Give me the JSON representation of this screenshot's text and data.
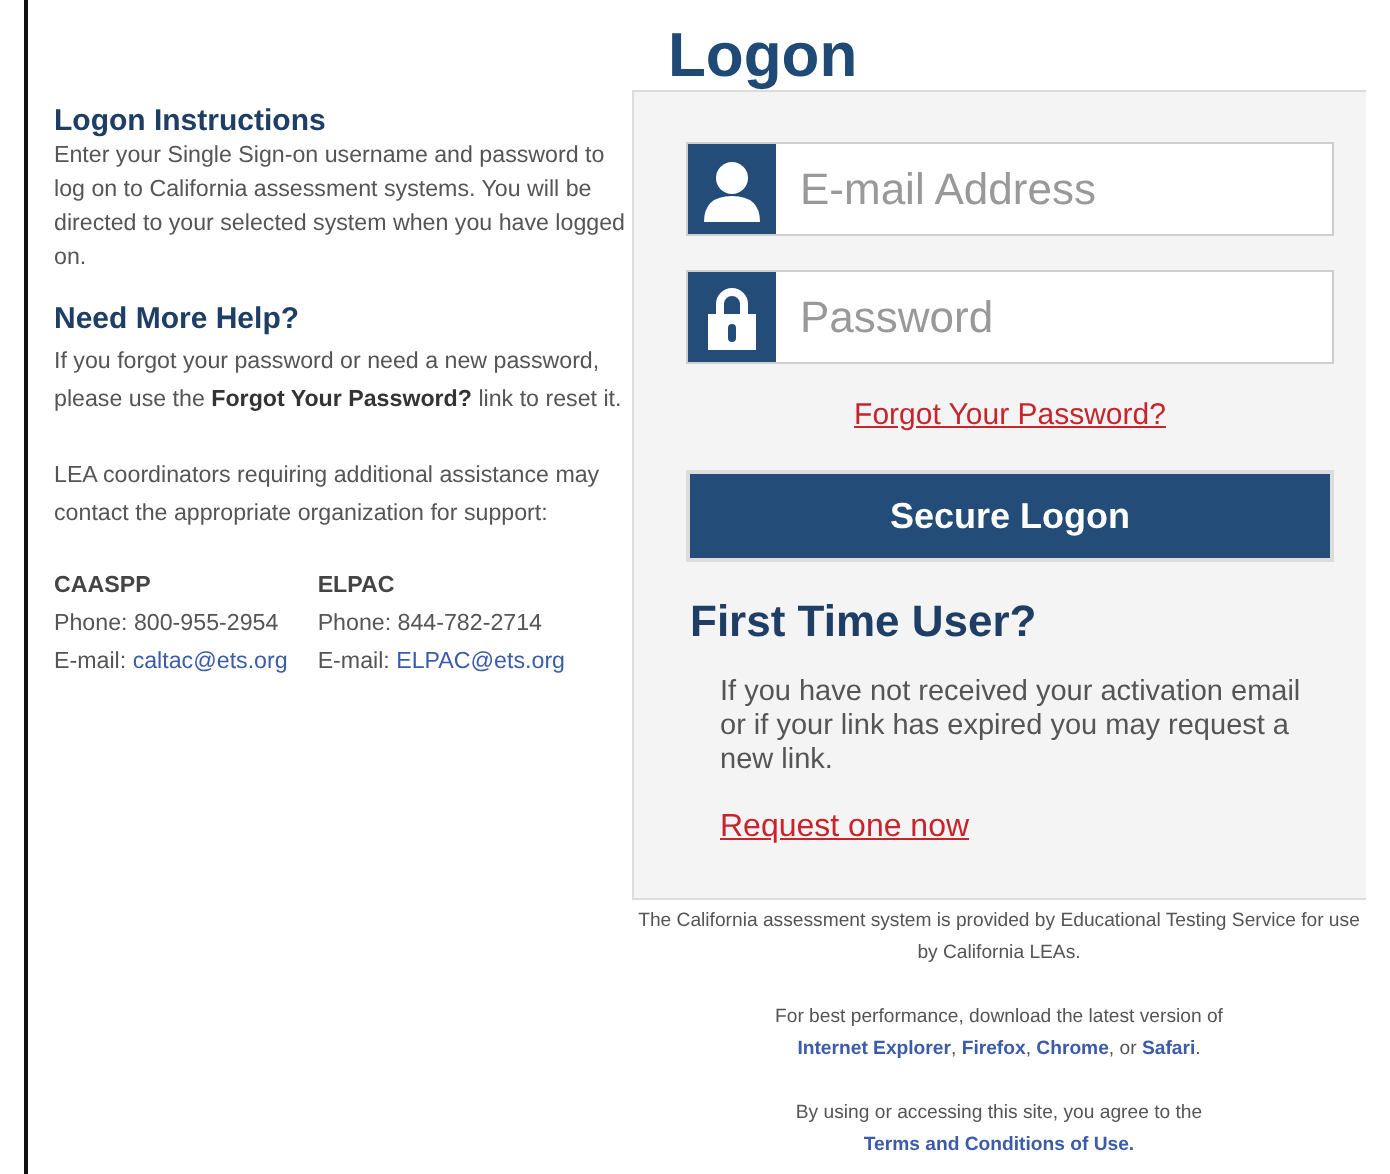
{
  "title": "Logon",
  "instructions": {
    "heading": "Logon Instructions",
    "text": "Enter your Single Sign-on username and password to log on to California assessment systems. You will be directed to your selected system when you have logged on."
  },
  "help": {
    "heading": "Need More Help?",
    "paragraphs": [
      "If you forgot your password or need a new password, please use the **Forgot Your Password?** link to reset it.",
      "LEA coordinators requiring additional assistance may contact the appropriate organization for support:"
    ]
  },
  "contacts": [
    {
      "name": "CAASPP",
      "phone": "Phone: 800-955-2954",
      "email_label": "E-mail:",
      "email": "caltac@ets.org"
    },
    {
      "name": "ELPAC",
      "phone": "Phone: 844-782-2714",
      "email_label": "E-mail:",
      "email": "ELPAC@ets.org"
    }
  ],
  "form": {
    "fields": [
      {
        "kind": "user",
        "placeholder": "E-mail Address"
      },
      {
        "kind": "lock",
        "placeholder": "Password"
      }
    ],
    "forgot_link": "Forgot Your Password?",
    "submit": "Secure Logon",
    "first_time": {
      "heading": "First Time User?",
      "text": "If you have not received your activation email or if your link has expired you may request a new link.",
      "link": "Request one now"
    }
  },
  "footer": {
    "provider": "The California assessment system is provided by Educational Testing Service for use by California LEAs.",
    "browsers_intro": "For best performance, download the latest version of",
    "browsers": [
      {
        "kind": "link",
        "text": "Internet Explorer"
      },
      {
        "kind": "text",
        "text": ", "
      },
      {
        "kind": "link",
        "text": "Firefox"
      },
      {
        "kind": "text",
        "text": ", "
      },
      {
        "kind": "link",
        "text": "Chrome"
      },
      {
        "kind": "text",
        "text": ", or "
      },
      {
        "kind": "link",
        "text": "Safari"
      },
      {
        "kind": "text",
        "text": "."
      }
    ],
    "terms_intro": "By using or accessing this site, you agree to the",
    "terms_link": "Terms and Conditions of Use."
  }
}
